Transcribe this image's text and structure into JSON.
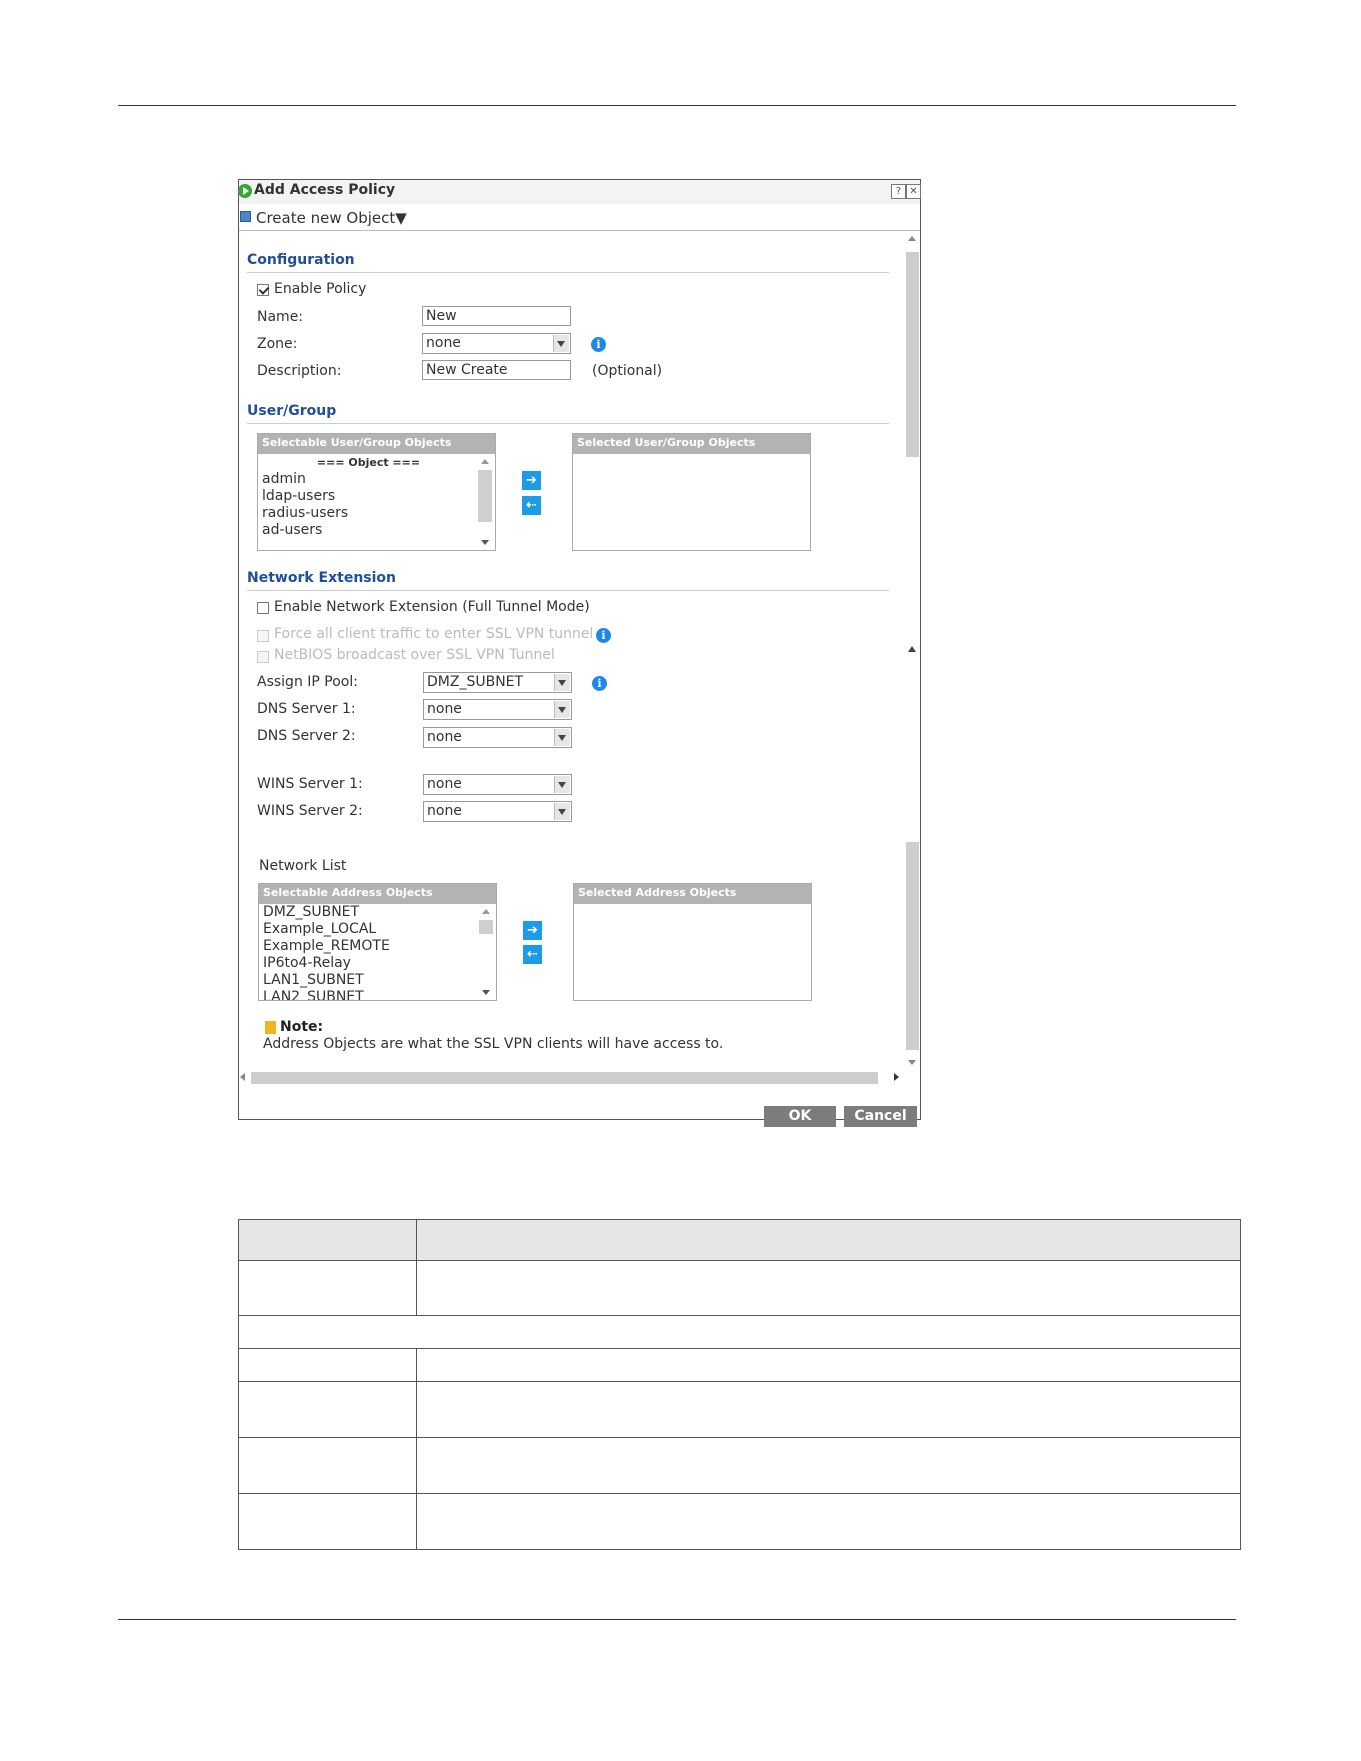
{
  "dialog": {
    "title": "Add Access Policy",
    "toolbar_label": "Create new Object▼",
    "help_icon": "?",
    "close_icon": "✕"
  },
  "configuration": {
    "section_title": "Configuration",
    "enable_policy_label": "Enable Policy",
    "enable_policy_checked": true,
    "name_label": "Name:",
    "name_value": "New",
    "zone_label": "Zone:",
    "zone_value": "none",
    "description_label": "Description:",
    "description_value": "New Create",
    "description_hint": "(Optional)"
  },
  "user_group": {
    "section_title": "User/Group",
    "selectable_header": "Selectable User/Group Objects",
    "selected_header": "Selected User/Group Objects",
    "group_label": "=== Object ===",
    "items": [
      "admin",
      "ldap-users",
      "radius-users",
      "ad-users"
    ],
    "add_arrow": "➔",
    "remove_arrow": "⇠"
  },
  "network_extension": {
    "section_title": "Network Extension",
    "enable_label": "Enable Network Extension (Full Tunnel Mode)",
    "force_label": "Force all client traffic to enter SSL VPN tunnel",
    "netbios_label": "NetBIOS broadcast over SSL VPN Tunnel",
    "assign_ip_label": "Assign IP Pool:",
    "assign_ip_value": "DMZ_SUBNET",
    "dns1_label": "DNS Server 1:",
    "dns1_value": "none",
    "dns2_label": "DNS Server 2:",
    "dns2_value": "none",
    "wins1_label": "WINS Server 1:",
    "wins1_value": "none",
    "wins2_label": "WINS Server 2:",
    "wins2_value": "none",
    "network_list_label": "Network List",
    "selectable_header": "Selectable Address Objects",
    "selected_header": "Selected Address Objects",
    "items": [
      "DMZ_SUBNET",
      "Example_LOCAL",
      "Example_REMOTE",
      "IP6to4-Relay",
      "LAN1_SUBNET",
      "LAN2_SUBNET"
    ]
  },
  "note": {
    "title": "Note:",
    "text": "Address Objects are what the SSL VPN clients will have access to."
  },
  "buttons": {
    "ok": "OK",
    "cancel": "Cancel"
  },
  "colors": {
    "section_title": "#1f4f9a",
    "arrow_button": "#1e9be8",
    "info_icon": "#1e88e5",
    "footer_button": "#7c7c7c"
  }
}
